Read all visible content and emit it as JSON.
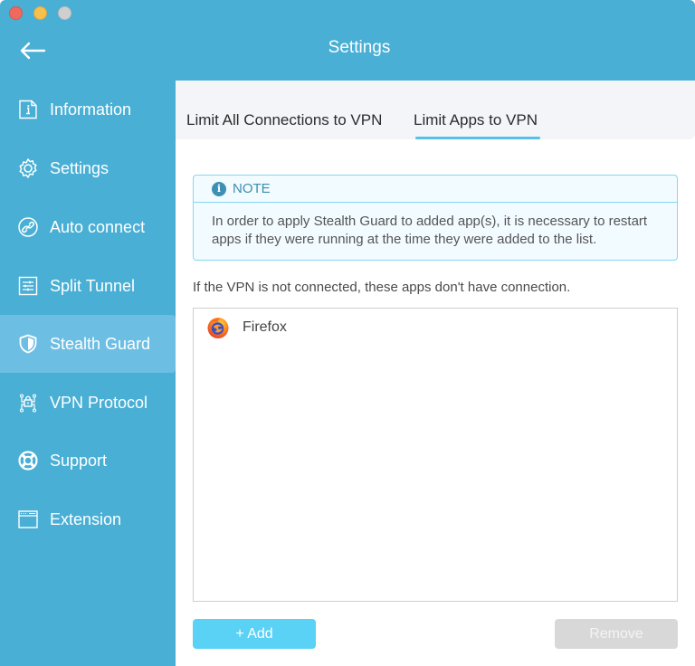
{
  "window": {
    "title": "Settings",
    "back_icon": "arrow-left-icon"
  },
  "colors": {
    "brand": "#49afd5",
    "active_nav": "#6dbee3",
    "accent": "#59d2f6",
    "disabled": "#d8d8d8",
    "note_border": "#84d8f2"
  },
  "sidebar": {
    "items": [
      {
        "label": "Information",
        "icon": "info-document-icon",
        "active": false
      },
      {
        "label": "Settings",
        "icon": "gear-icon",
        "active": false
      },
      {
        "label": "Auto connect",
        "icon": "link-circle-icon",
        "active": false
      },
      {
        "label": "Split Tunnel",
        "icon": "sliders-icon",
        "active": false
      },
      {
        "label": "Stealth Guard",
        "icon": "shield-icon",
        "active": true
      },
      {
        "label": "VPN Protocol",
        "icon": "network-lock-icon",
        "active": false
      },
      {
        "label": "Support",
        "icon": "lifebuoy-icon",
        "active": false
      },
      {
        "label": "Extension",
        "icon": "browser-window-icon",
        "active": false
      }
    ]
  },
  "tabs": [
    {
      "label": "Limit All Connections to VPN",
      "active": false
    },
    {
      "label": "Limit Apps to VPN",
      "active": true
    }
  ],
  "note": {
    "title": "NOTE",
    "icon": "info-circle-icon",
    "body": "In order to apply Stealth Guard to added app(s), it is necessary to restart apps if they were running at the time they were added to the list."
  },
  "hint": "If the VPN is not connected, these apps don't have connection.",
  "apps": [
    {
      "name": "Firefox",
      "icon": "firefox-icon"
    }
  ],
  "buttons": {
    "add": "+ Add",
    "remove": "Remove"
  }
}
